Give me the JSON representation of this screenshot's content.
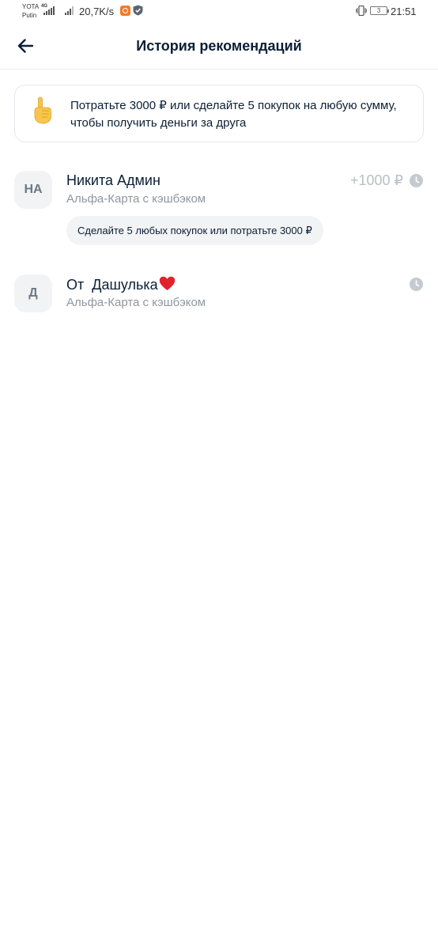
{
  "status_bar": {
    "carrier_top": "YOTA",
    "carrier_bottom": "Putin",
    "network": "4G",
    "speed": "20,7K/s",
    "battery": "3",
    "time": "21:51"
  },
  "header": {
    "title": "История рекомендаций"
  },
  "info_card": {
    "emoji": "☝",
    "text": "Потратьте 3000 ₽ или сделайте 5 покупок на любую сумму, чтобы получить деньги за друга"
  },
  "referrals": [
    {
      "initials": "НА",
      "name": "Никита Админ",
      "product": "Альфа-Карта с кэшбэком",
      "amount": "+1000 ₽",
      "condition": "Сделайте 5 любых покупок или потратьте 3000 ₽",
      "status_icon": "clock-icon"
    },
    {
      "initials": "Д",
      "name": "От  Дашулька",
      "name_emoji": "❤️",
      "product": "Альфа-Карта с кэшбэком",
      "status_icon": "clock-icon"
    }
  ],
  "colors": {
    "text_primary": "#0b1f35",
    "text_secondary": "#8e979f",
    "amount_muted": "#b9bfc5",
    "chip_bg": "#f2f3f5",
    "card_border": "#e4e7eb",
    "clock_grey": "#c5cad0",
    "heart_red": "#e0232e"
  }
}
